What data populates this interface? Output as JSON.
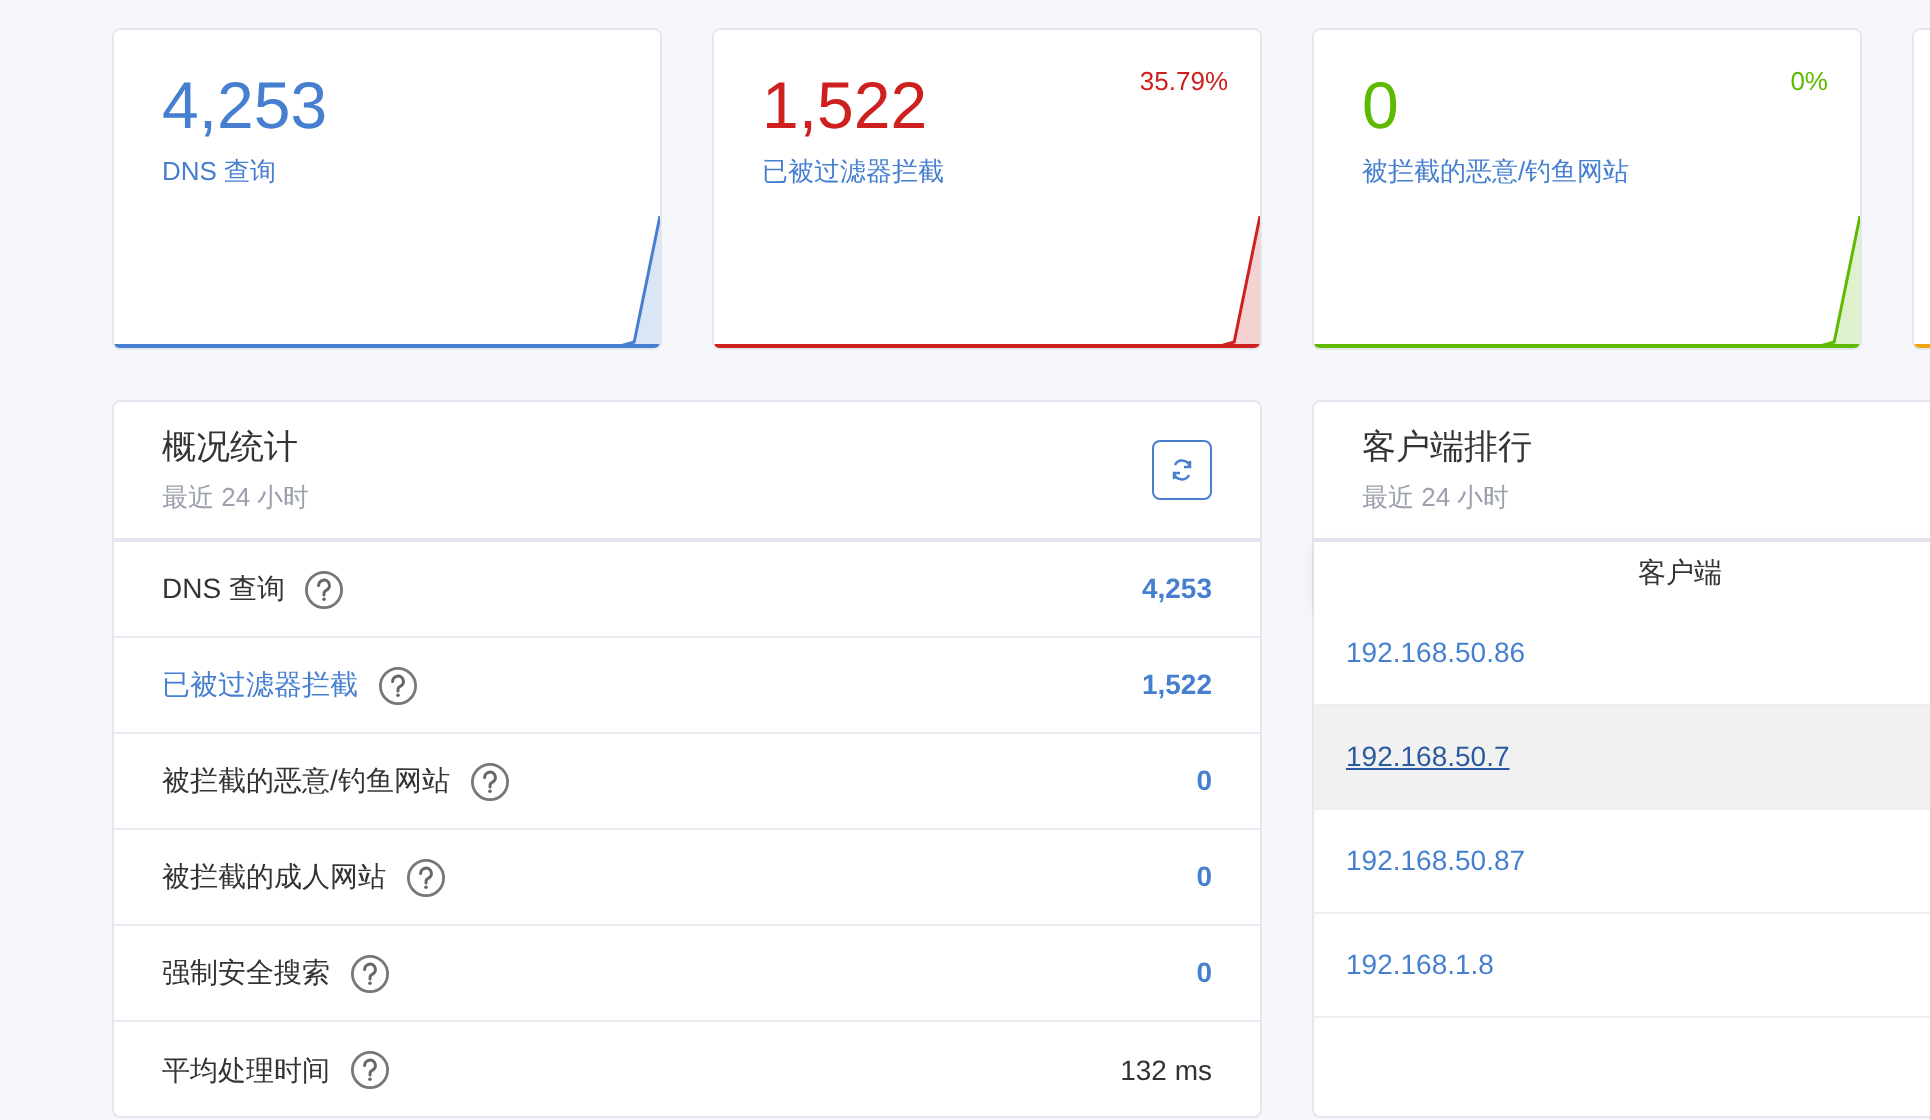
{
  "stat_cards": [
    {
      "value": "4,253",
      "label": "DNS 查询",
      "color": "#467fcf"
    },
    {
      "value": "1,522",
      "label": "已被过滤器拦截",
      "percent": "35.79%",
      "color": "#cd201f"
    },
    {
      "value": "0",
      "label": "被拦截的恶意/钓鱼网站",
      "percent": "0%",
      "color": "#5eba00"
    },
    {
      "color": "#f1a40f"
    }
  ],
  "overview": {
    "title": "概况统计",
    "subtitle": "最近 24 小时",
    "rows": [
      {
        "label": "DNS 查询",
        "link": false,
        "value": "4,253",
        "highlighted": true
      },
      {
        "label": "已被过滤器拦截",
        "link": true,
        "value": "1,522",
        "highlighted": true
      },
      {
        "label": "被拦截的恶意/钓鱼网站",
        "link": false,
        "value": "0",
        "highlighted": true
      },
      {
        "label": "被拦截的成人网站",
        "link": false,
        "value": "0",
        "highlighted": true
      },
      {
        "label": "强制安全搜索",
        "link": false,
        "value": "0",
        "highlighted": true
      },
      {
        "label": "平均处理时间",
        "link": false,
        "value": "132 ms",
        "highlighted": false
      }
    ]
  },
  "clients": {
    "title": "客户端排行",
    "subtitle": "最近 24 小时",
    "column": "客户端",
    "rows": [
      {
        "client": "192.168.50.86",
        "hovered": false
      },
      {
        "client": "192.168.50.7",
        "hovered": true
      },
      {
        "client": "192.168.50.87",
        "hovered": false
      },
      {
        "client": "192.168.1.8",
        "hovered": false
      }
    ]
  }
}
